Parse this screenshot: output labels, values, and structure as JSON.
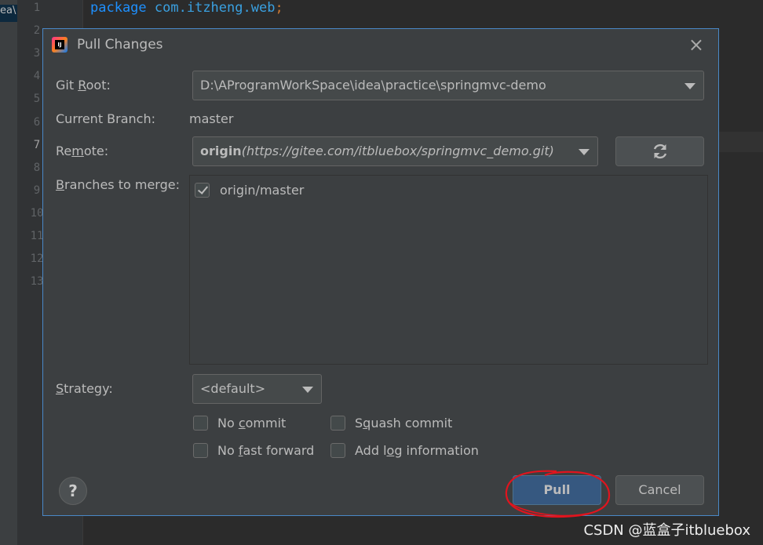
{
  "editor": {
    "crumb_text": "ea\\",
    "line_numbers": [
      "1",
      "2",
      "3",
      "4",
      "5",
      "6",
      "7",
      "8",
      "9",
      "10",
      "11",
      "12",
      "13"
    ],
    "code_keyword": "package",
    "code_package": "com.itzheng.web",
    "code_semicolon": ";"
  },
  "dialog": {
    "title": "Pull Changes",
    "logo_text": "IJ",
    "close_icon": "×",
    "git_root_label": "Git Root:",
    "git_root_value": "D:\\AProgramWorkSpace\\idea\\practice\\springmvc-demo",
    "current_branch_label": "Current Branch:",
    "current_branch_value": "master",
    "remote_label": "Remote:",
    "remote_name": "origin",
    "remote_url": "(https://gitee.com/itbluebox/springmvc_demo.git)",
    "refresh_icon": "refresh-icon",
    "branches_label": "Branches to merge:",
    "branches": [
      {
        "name": "origin/master",
        "checked": true
      }
    ],
    "strategy_label": "Strategy:",
    "strategy_value": "<default>",
    "options": {
      "no_commit": {
        "label": "No commit",
        "checked": false
      },
      "squash_commit": {
        "label": "Squash commit",
        "checked": false
      },
      "no_fast_forward": {
        "label": "No fast forward",
        "checked": false
      },
      "add_log": {
        "label": "Add log information",
        "checked": false
      }
    },
    "help_symbol": "?",
    "pull_label": "Pull",
    "cancel_label": "Cancel"
  },
  "watermark": "CSDN @蓝盒子itbluebox",
  "colors": {
    "dialog_bg": "#3c3f41",
    "dialog_border": "#4a88c7",
    "primary_button": "#365880",
    "annotation": "#e0141e"
  }
}
